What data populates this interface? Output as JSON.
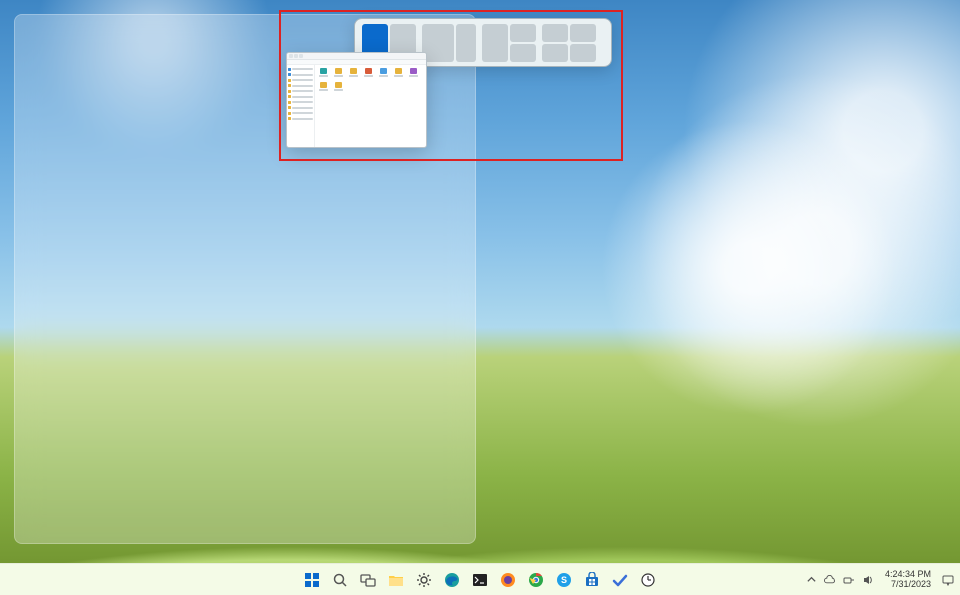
{
  "annotation": {
    "purpose": "highlight-snap-layouts"
  },
  "snap_layouts": {
    "options": [
      {
        "name": "split-two-equal",
        "selected_zone": 0
      },
      {
        "name": "split-two-left-large"
      },
      {
        "name": "three-columns"
      },
      {
        "name": "left-half-right-stack"
      },
      {
        "name": "four-quarters"
      }
    ]
  },
  "explorer_thumbnail": {
    "title": "File Explorer",
    "sidebar_items": [
      "Home",
      "Gallery",
      "OneDrive",
      "Desktop",
      "Downloads",
      "Documents",
      "Pictures",
      "Music",
      "Videos",
      "This PC"
    ],
    "main_items": [
      "Desktop",
      "Downloads",
      "Documents",
      "Pictures",
      "Music",
      "Videos",
      "Archives",
      "Projects",
      "Media"
    ]
  },
  "taskbar": {
    "apps": [
      {
        "name": "start",
        "label": "Start"
      },
      {
        "name": "search",
        "label": "Search"
      },
      {
        "name": "task-view",
        "label": "Task View"
      },
      {
        "name": "file-explorer",
        "label": "File Explorer"
      },
      {
        "name": "settings",
        "label": "Settings"
      },
      {
        "name": "edge",
        "label": "Microsoft Edge"
      },
      {
        "name": "terminal",
        "label": "Terminal"
      },
      {
        "name": "firefox",
        "label": "Firefox"
      },
      {
        "name": "chrome",
        "label": "Google Chrome"
      },
      {
        "name": "skype",
        "label": "Skype"
      },
      {
        "name": "store",
        "label": "Microsoft Store"
      },
      {
        "name": "todo",
        "label": "To Do"
      },
      {
        "name": "clock",
        "label": "Clock"
      }
    ],
    "tray": {
      "chevron": "Show hidden icons",
      "onedrive": "OneDrive",
      "network": "Network",
      "volume": "Volume",
      "time": "4:24:34 PM",
      "date": "7/31/2023",
      "notifications": "Notifications"
    }
  }
}
